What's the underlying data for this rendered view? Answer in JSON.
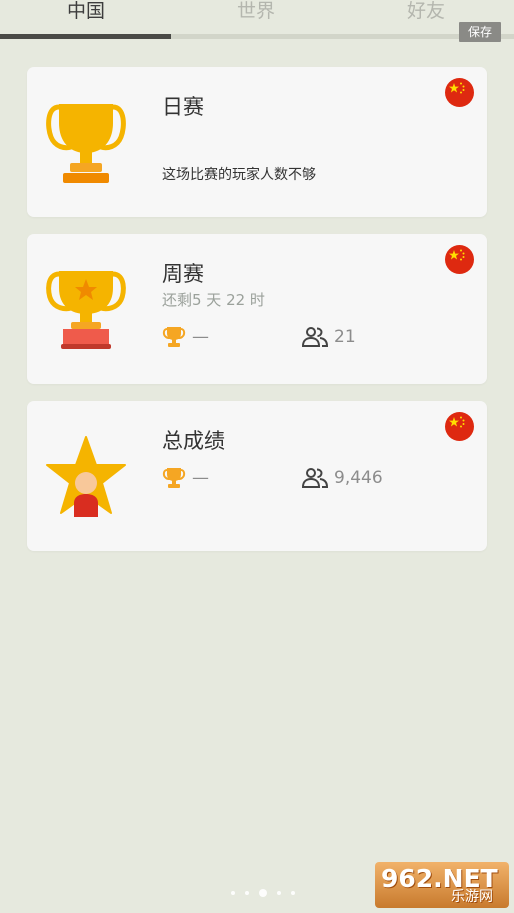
{
  "tabs": [
    {
      "label": "中国",
      "active": true
    },
    {
      "label": "世界",
      "active": false
    },
    {
      "label": "好友",
      "active": false
    }
  ],
  "save_label": "保存",
  "cards": [
    {
      "title": "日赛",
      "icon": "gold-trophy-icon",
      "message": "这场比赛的玩家人数不够",
      "flag": "china-flag-icon"
    },
    {
      "title": "周赛",
      "icon": "trophy-with-star-icon",
      "remaining": "还剩5 天 22 时",
      "rank": "—",
      "players": "21",
      "flag": "china-flag-icon"
    },
    {
      "title": "总成绩",
      "icon": "star-with-person-icon",
      "rank": "—",
      "players": "9,446",
      "flag": "china-flag-icon"
    }
  ],
  "pager": {
    "count": 5,
    "active": 2
  },
  "watermark": {
    "top": "962.NET",
    "bottom": "乐游网"
  },
  "colors": {
    "background": "#e6e9de",
    "card": "#f7f7f7",
    "trophy_gold": "#f5b400",
    "trophy_small": "#f5a623",
    "flag_red": "#de2910"
  }
}
